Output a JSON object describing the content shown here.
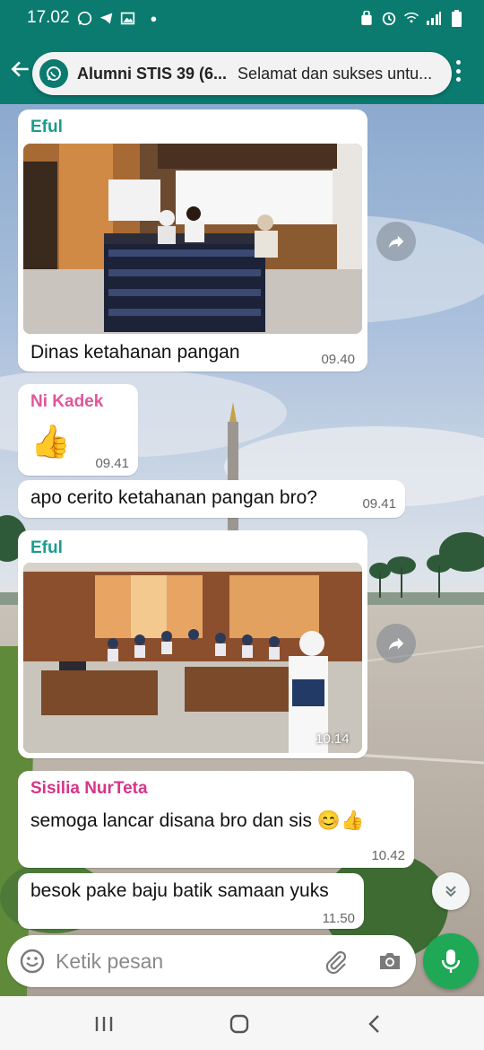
{
  "status_bar": {
    "time": "17.02",
    "left_icons": [
      "whatsapp-icon",
      "telegram-icon",
      "gallery-icon",
      "dot"
    ],
    "right_icons": [
      "alarm-icon",
      "clock-icon",
      "wifi-icon",
      "signal-icon",
      "battery-icon"
    ]
  },
  "header": {
    "notification_title": "Alumni STIS 39 (6...",
    "notification_text": "Selamat dan sukses untu..."
  },
  "messages": [
    {
      "sender": "Eful",
      "sender_color": "#1a9d8c",
      "has_photo": true,
      "text": "Dinas ketahanan pangan",
      "time": "09.40"
    },
    {
      "sender": "Ni Kadek",
      "sender_color": "#e0569a",
      "emoji": "👍",
      "time": "09.41"
    },
    {
      "sender": "",
      "text": "apo cerito ketahanan pangan bro?",
      "time": "09.41"
    },
    {
      "sender": "Eful",
      "sender_color": "#1a9d8c",
      "has_photo": true,
      "time": "10.14"
    },
    {
      "sender": "Sisilia NurTeta",
      "sender_color": "#d6348a",
      "text": "semoga lancar disana bro dan sis 😊👍",
      "time": "10.42"
    },
    {
      "sender": "",
      "text": "besok pake baju batik samaan yuks",
      "time": "11.50"
    }
  ],
  "input": {
    "placeholder": "Ketik pesan"
  },
  "colors": {
    "header": "#0b7a6f",
    "mic": "#1fa855",
    "bubble": "#ffffff"
  }
}
